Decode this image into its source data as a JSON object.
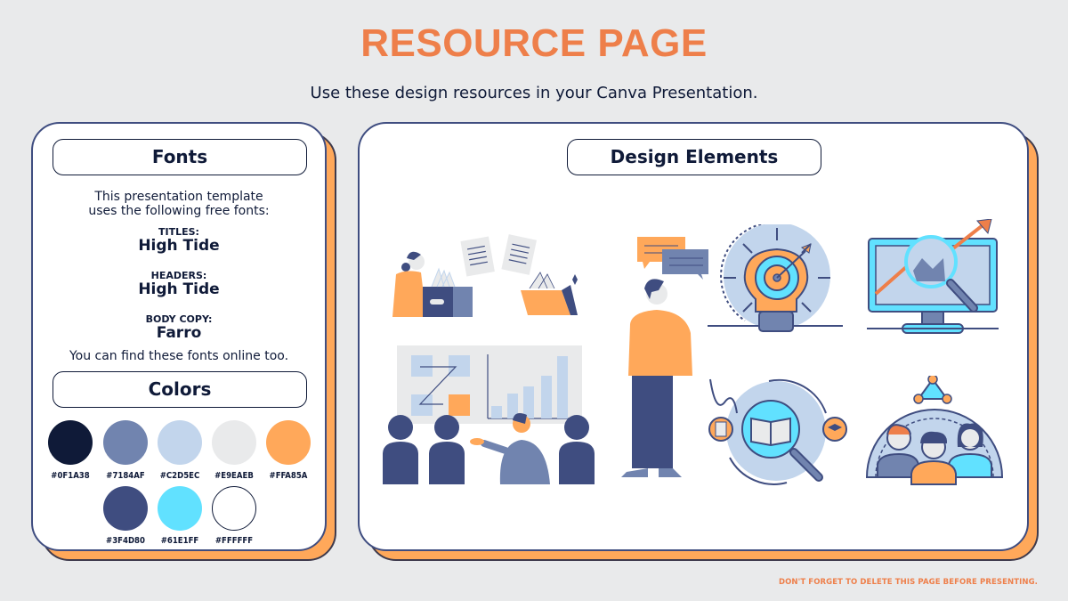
{
  "header": {
    "title": "RESOURCE PAGE",
    "subtitle": "Use these design resources in your Canva Presentation."
  },
  "fonts_panel": {
    "heading": "Fonts",
    "intro_line1": "This presentation template",
    "intro_line2": "uses the following free fonts:",
    "entries": [
      {
        "label": "TITLES:",
        "font": "High Tide"
      },
      {
        "label": "HEADERS:",
        "font": "High Tide"
      },
      {
        "label": "BODY COPY:",
        "font": "Farro"
      }
    ],
    "outro": "You can find these fonts online too."
  },
  "colors_panel": {
    "heading": "Colors",
    "swatches": [
      {
        "hex": "#0F1A38",
        "label": "#0F1A38"
      },
      {
        "hex": "#7184AF",
        "label": "#7184AF"
      },
      {
        "hex": "#C2D5EC",
        "label": "#C2D5EC"
      },
      {
        "hex": "#E9EAEB",
        "label": "#E9EAEB"
      },
      {
        "hex": "#FFA85A",
        "label": "#FFA85A"
      },
      {
        "hex": "#3F4D80",
        "label": "#3F4D80"
      },
      {
        "hex": "#61E1FF",
        "label": "#61E1FF"
      },
      {
        "hex": "#FFFFFF",
        "label": "#FFFFFF"
      }
    ]
  },
  "design_panel": {
    "heading": "Design Elements",
    "elements": [
      {
        "icon": "filing-documents-illustration"
      },
      {
        "icon": "presentation-meeting-illustration"
      },
      {
        "icon": "thinking-man-illustration"
      },
      {
        "icon": "lightbulb-target-icon"
      },
      {
        "icon": "book-search-cycle-icon"
      },
      {
        "icon": "monitor-analytics-icon"
      },
      {
        "icon": "team-network-icon"
      }
    ]
  },
  "footer": {
    "note": "DON'T FORGET TO DELETE THIS PAGE BEFORE PRESENTING."
  },
  "theme": {
    "accent": "#EE7F4A",
    "background": "#E9EAEB",
    "card_shadow": "#FFA85A",
    "card_border": "#3F4D80"
  }
}
